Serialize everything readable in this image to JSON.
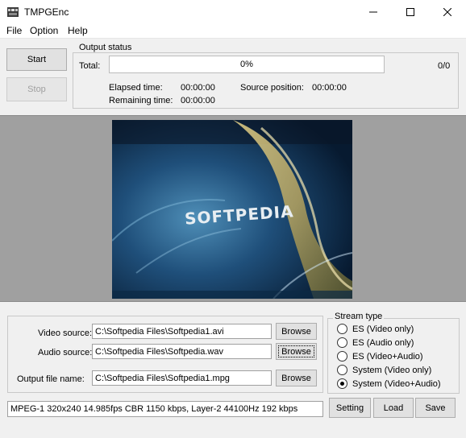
{
  "window": {
    "title": "TMPGEnc",
    "controls": [
      "minimize",
      "maximize",
      "close"
    ]
  },
  "menu": {
    "items": [
      {
        "label": "File"
      },
      {
        "label": "Option"
      },
      {
        "label": "Help"
      }
    ]
  },
  "controls": {
    "start_label": "Start",
    "stop_label": "Stop"
  },
  "output_status": {
    "title": "Output status",
    "total_label": "Total:",
    "progress_text": "0%",
    "progress_value": 0,
    "count": "0/0",
    "elapsed_label": "Elapsed time:",
    "elapsed_value": "00:00:00",
    "remaining_label": "Remaining time:",
    "remaining_value": "00:00:00",
    "source_position_label": "Source position:",
    "source_position_value": "00:00:00"
  },
  "preview": {
    "watermark_text": "SOFTPEDIA"
  },
  "files": {
    "video_source_label": "Video source:",
    "video_source_value": "C:\\Softpedia Files\\Softpedia1.avi",
    "audio_source_label": "Audio source:",
    "audio_source_value": "C:\\Softpedia Files\\Softpedia.wav",
    "output_file_label": "Output file name:",
    "output_file_value": "C:\\Softpedia Files\\Softpedia1.mpg",
    "browse_label": "Browse"
  },
  "stream_type": {
    "title": "Stream type",
    "options": [
      {
        "label": "ES (Video only)",
        "checked": false
      },
      {
        "label": "ES (Audio only)",
        "checked": false
      },
      {
        "label": "ES (Video+Audio)",
        "checked": false
      },
      {
        "label": "System (Video only)",
        "checked": false
      },
      {
        "label": "System (Video+Audio)",
        "checked": true
      }
    ]
  },
  "status_line": "MPEG-1 320x240 14.985fps CBR 1150 kbps,  Layer-2 44100Hz 192 kbps",
  "bottom_buttons": {
    "setting_label": "Setting",
    "load_label": "Load",
    "save_label": "Save"
  }
}
